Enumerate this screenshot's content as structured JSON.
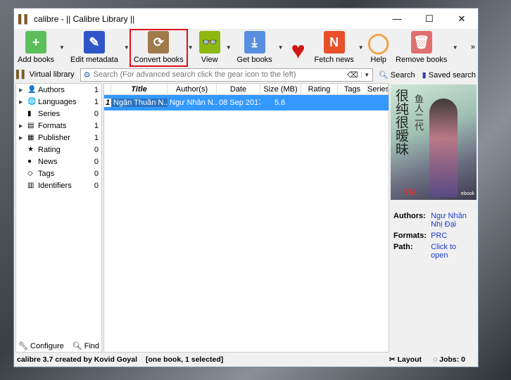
{
  "window": {
    "title": "calibre - || Calibre Library ||",
    "minimize": "—",
    "maximize": "☐",
    "close": "✕"
  },
  "toolbar": [
    {
      "label": "Add books",
      "icon": "add-books-icon",
      "color": "#5cbf5c",
      "glyph": "+",
      "dropdown": true
    },
    {
      "label": "Edit metadata",
      "icon": "edit-metadata-icon",
      "color": "#2f55c8",
      "glyph": "✎",
      "dropdown": true
    },
    {
      "label": "Convert books",
      "icon": "convert-books-icon",
      "color": "#a07a4a",
      "glyph": "⟳",
      "dropdown": true,
      "highlighted": true
    },
    {
      "label": "View",
      "icon": "view-icon",
      "color": "#8db812",
      "glyph": "👓",
      "dropdown": true
    },
    {
      "label": "Get books",
      "icon": "get-books-icon",
      "color": "#5a8fe0",
      "glyph": "⤓",
      "dropdown": true
    },
    {
      "label": "",
      "icon": "heart-icon",
      "color": "#d01818",
      "glyph": "♥",
      "dropdown": false
    },
    {
      "label": "Fetch news",
      "icon": "fetch-news-icon",
      "color": "#e8502a",
      "glyph": "N",
      "dropdown": true
    },
    {
      "label": "Help",
      "icon": "help-lifebuoy-icon",
      "color": "#f0a040",
      "glyph": "◯",
      "dropdown": false
    },
    {
      "label": "Remove books",
      "icon": "remove-books-icon",
      "color": "#e07070",
      "glyph": "🗑",
      "dropdown": true
    }
  ],
  "more": "»",
  "search": {
    "virtual_library": "Virtual library",
    "placeholder": "Search (For advanced search click the gear icon to the left)",
    "search_label": "Search",
    "saved_search": "Saved search"
  },
  "tree": [
    {
      "label": "Authors",
      "count": "1",
      "icon": "👤",
      "expand": true
    },
    {
      "label": "Languages",
      "count": "1",
      "icon": "🌐",
      "expand": true
    },
    {
      "label": "Series",
      "count": "0",
      "icon": "▮",
      "expand": false
    },
    {
      "label": "Formats",
      "count": "1",
      "icon": "▤",
      "expand": true
    },
    {
      "label": "Publisher",
      "count": "1",
      "icon": "▦",
      "expand": true
    },
    {
      "label": "Rating",
      "count": "0",
      "icon": "★",
      "expand": false
    },
    {
      "label": "News",
      "count": "0",
      "icon": "●",
      "expand": false
    },
    {
      "label": "Tags",
      "count": "0",
      "icon": "◇",
      "expand": false
    },
    {
      "label": "Identifiers",
      "count": "0",
      "icon": "▥",
      "expand": false
    }
  ],
  "left_footer": {
    "configure": "Configure",
    "find": "Find"
  },
  "columns": [
    "Title",
    "Author(s)",
    "Date",
    "Size (MB)",
    "Rating",
    "Tags",
    "Series"
  ],
  "books": [
    {
      "num": "1",
      "title": "Ngận Thuần N...",
      "author": "Ngư Nhân N...",
      "date": "08 Sep 2017",
      "size": "5.6"
    }
  ],
  "details": {
    "authors_label": "Authors:",
    "authors": "Ngư Nhân Nhị Đại",
    "formats_label": "Formats:",
    "formats": "PRC",
    "path_label": "Path:",
    "path": "Click to open",
    "cover_text": "很纯很暧昧 鱼人二代 VN ebook"
  },
  "status": {
    "left": "calibre 3.7 created by Kovid Goyal",
    "selection": "[one book, 1 selected]",
    "layout": "Layout",
    "jobs": "Jobs: 0"
  }
}
